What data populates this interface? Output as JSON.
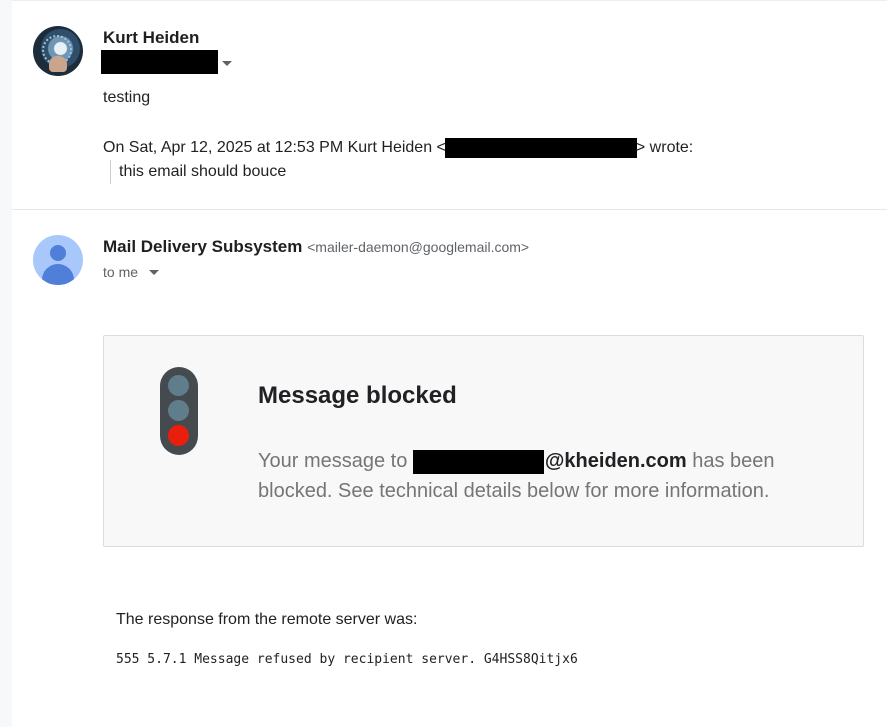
{
  "message1": {
    "sender_name": "Kurt Heiden",
    "body": "testing",
    "quote_intro_prefix": "On Sat, Apr 12, 2025 at 12:53 PM Kurt Heiden <",
    "quote_intro_suffix": "> wrote:",
    "quoted_text": "this email should bouce"
  },
  "message2": {
    "sender_name": "Mail Delivery Subsystem",
    "sender_email": "<mailer-daemon@googlemail.com>",
    "recipient_line": "to me"
  },
  "bounce_card": {
    "title": "Message blocked",
    "desc_prefix": "Your message to ",
    "recipient_domain": "@kheiden.com",
    "desc_suffix": " has been blocked. See technical details below for more information."
  },
  "response": {
    "label": "The response from the remote server was:",
    "code": "555 5.7.1 Message refused by recipient server. G4HSS8Qitjx6"
  }
}
